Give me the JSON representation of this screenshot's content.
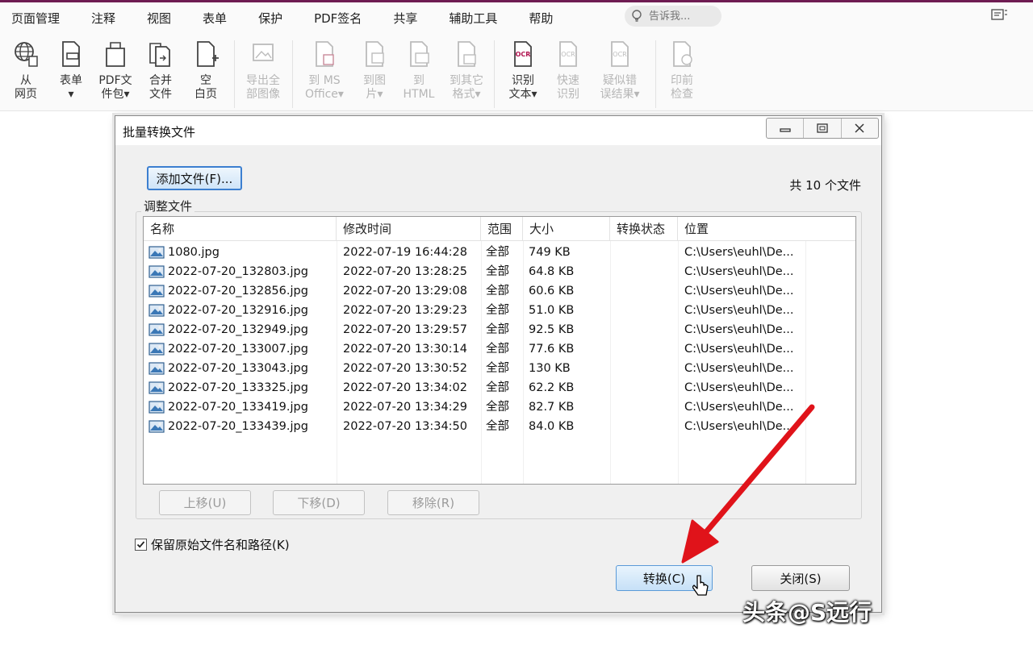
{
  "menu": {
    "items": [
      "页面管理",
      "注释",
      "视图",
      "表单",
      "保护",
      "PDF签名",
      "共享",
      "辅助工具",
      "帮助"
    ],
    "search_placeholder": "告诉我..."
  },
  "ribbon": {
    "buttons": [
      {
        "line1": "从",
        "line2": "网页",
        "icon": "web-globe-icon",
        "enabled": true
      },
      {
        "line1": "表单",
        "line2": "▾",
        "icon": "form-doc-icon",
        "enabled": true
      },
      {
        "line1": "PDF文",
        "line2": "件包▾",
        "icon": "pdf-package-icon",
        "enabled": true
      },
      {
        "line1": "合并",
        "line2": "文件",
        "icon": "merge-files-icon",
        "enabled": true
      },
      {
        "line1": "空",
        "line2": "白页",
        "icon": "blank-page-icon",
        "enabled": true
      },
      {
        "line1": "导出全",
        "line2": "部图像",
        "icon": "export-images-icon",
        "enabled": false
      },
      {
        "line1": "到 MS",
        "line2": "Office▾",
        "icon": "to-office-icon",
        "enabled": false
      },
      {
        "line1": "到图",
        "line2": "片▾",
        "icon": "to-image-icon",
        "enabled": false
      },
      {
        "line1": "到",
        "line2": "HTML",
        "icon": "to-html-icon",
        "enabled": false
      },
      {
        "line1": "到其它",
        "line2": "格式▾",
        "icon": "to-other-format-icon",
        "enabled": false
      },
      {
        "line1": "识别",
        "line2": "文本▾",
        "icon": "ocr-text-icon",
        "enabled": true
      },
      {
        "line1": "快速",
        "line2": "识别",
        "icon": "quick-ocr-icon",
        "enabled": false
      },
      {
        "line1": "疑似错",
        "line2": "误结果▾",
        "icon": "ocr-suspect-icon",
        "enabled": false
      },
      {
        "line1": "印前",
        "line2": "检查",
        "icon": "preflight-icon",
        "enabled": false
      }
    ]
  },
  "dialog": {
    "title": "批量转换文件",
    "add_files_label": "添加文件(F)...",
    "file_count_label": "共 10 个文件",
    "group_label": "调整文件",
    "columns": [
      "名称",
      "修改时间",
      "范围",
      "大小",
      "转换状态",
      "位置"
    ],
    "rows": [
      [
        "1080.jpg",
        "2022-07-19 16:44:28",
        "全部",
        "749 KB",
        "",
        "C:\\Users\\euhl\\De..."
      ],
      [
        "2022-07-20_132803.jpg",
        "2022-07-20 13:28:25",
        "全部",
        "64.8 KB",
        "",
        "C:\\Users\\euhl\\De..."
      ],
      [
        "2022-07-20_132856.jpg",
        "2022-07-20 13:29:08",
        "全部",
        "60.6 KB",
        "",
        "C:\\Users\\euhl\\De..."
      ],
      [
        "2022-07-20_132916.jpg",
        "2022-07-20 13:29:23",
        "全部",
        "51.0 KB",
        "",
        "C:\\Users\\euhl\\De..."
      ],
      [
        "2022-07-20_132949.jpg",
        "2022-07-20 13:29:57",
        "全部",
        "92.5 KB",
        "",
        "C:\\Users\\euhl\\De..."
      ],
      [
        "2022-07-20_133007.jpg",
        "2022-07-20 13:30:14",
        "全部",
        "77.6 KB",
        "",
        "C:\\Users\\euhl\\De..."
      ],
      [
        "2022-07-20_133043.jpg",
        "2022-07-20 13:30:52",
        "全部",
        "130 KB",
        "",
        "C:\\Users\\euhl\\De..."
      ],
      [
        "2022-07-20_133325.jpg",
        "2022-07-20 13:34:02",
        "全部",
        "62.2 KB",
        "",
        "C:\\Users\\euhl\\De..."
      ],
      [
        "2022-07-20_133419.jpg",
        "2022-07-20 13:34:29",
        "全部",
        "82.7 KB",
        "",
        "C:\\Users\\euhl\\De..."
      ],
      [
        "2022-07-20_133439.jpg",
        "2022-07-20 13:34:50",
        "全部",
        "84.0 KB",
        "",
        "C:\\Users\\euhl\\De..."
      ]
    ],
    "move_up_label": "上移(U)",
    "move_down_label": "下移(D)",
    "remove_label": "移除(R)",
    "keep_path_label": "保留原始文件名和路径(K)",
    "keep_path_checked": true,
    "convert_label": "转换(C)",
    "close_label": "关闭(S)"
  },
  "watermark": "头条@S远行",
  "colors": {
    "accent": "#6e1b52",
    "annotation_arrow": "#e0131a",
    "ocr_icon": "#b0134f"
  }
}
